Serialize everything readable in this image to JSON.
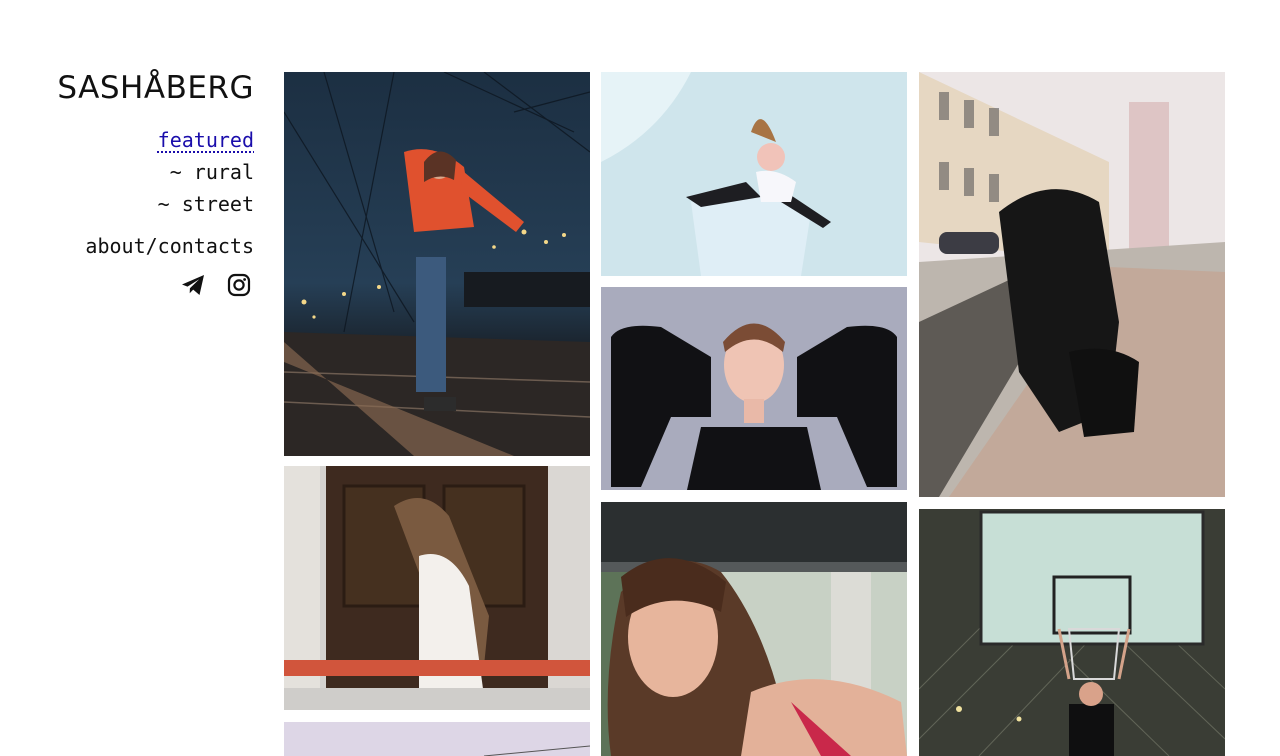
{
  "site": {
    "logo": "SASHÅBERG"
  },
  "nav": {
    "featured": "featured",
    "rural": "~ rural",
    "street": "~ street",
    "about": "about/contacts"
  },
  "social": {
    "icons": [
      "telegram-icon",
      "instagram-icon"
    ]
  },
  "colors": {
    "text": "#111111",
    "active_link": "#1a0dab",
    "background": "#ffffff"
  },
  "gallery": {
    "photos": [
      "night-railway-portrait",
      "snow-lying-portrait",
      "street-couple-walking",
      "grey-backdrop-portrait",
      "door-white-coat-portrait",
      "forest-gazebo-portrait",
      "basketball-hoop-portrait",
      "light-sky-photo"
    ]
  }
}
